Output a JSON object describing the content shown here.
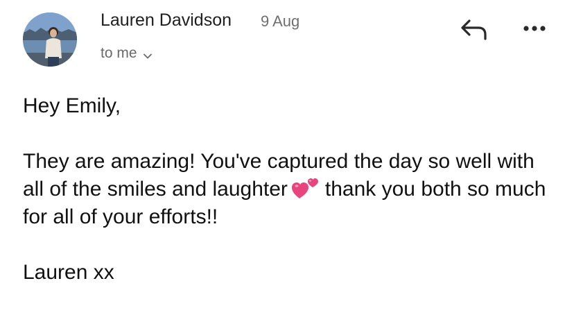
{
  "email": {
    "sender_name": "Lauren Davidson",
    "date": "9 Aug",
    "recipient_line": "to me",
    "greeting": "Hey Emily,",
    "message_part1": "They are amazing! You've captured the day so well with all of the smiles and laughter",
    "message_emoji": "two-hearts-icon",
    "message_part2": "thank you both so much for all of your efforts!!",
    "signoff": "Lauren xx"
  },
  "icons": {
    "reply": "reply-arrow-icon",
    "more": "more-horizontal-icon",
    "recipient_expand": "chevron-down-icon"
  },
  "colors": {
    "text": "#111111",
    "muted": "#6f6f6f",
    "heart": "#e8447d"
  }
}
